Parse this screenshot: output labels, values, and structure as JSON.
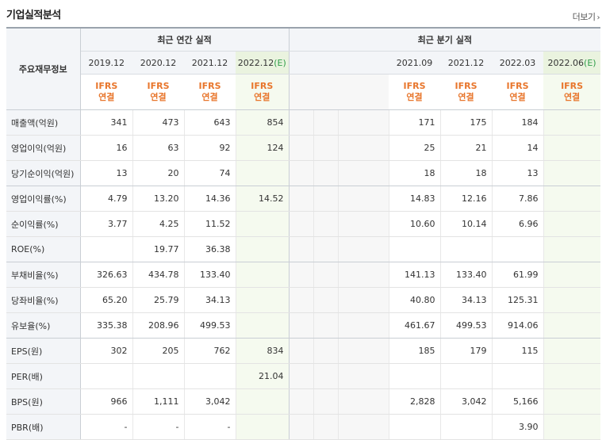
{
  "title": "기업실적분석",
  "more_label": "더보기",
  "label_header": "주요재무정보",
  "annual_header": "최근 연간 실적",
  "quarter_header": "최근 분기 실적",
  "annual_periods": [
    "2019.12",
    "2020.12",
    "2021.12",
    "2022.12"
  ],
  "annual_est_mark": "(E)",
  "quarter_periods": [
    "2021.09",
    "2021.12",
    "2022.03",
    "2022.06"
  ],
  "quarter_est_mark": "(E)",
  "ifrs_top": "IFRS",
  "ifrs_bottom": "연결",
  "rows": [
    {
      "label": "매출액(억원)",
      "annual": [
        "341",
        "473",
        "643",
        "854"
      ],
      "quarter": [
        "171",
        "175",
        "184",
        ""
      ]
    },
    {
      "label": "영업이익(억원)",
      "annual": [
        "16",
        "63",
        "92",
        "124"
      ],
      "quarter": [
        "25",
        "21",
        "14",
        ""
      ]
    },
    {
      "label": "당기순이익(억원)",
      "annual": [
        "13",
        "20",
        "74",
        ""
      ],
      "quarter": [
        "18",
        "18",
        "13",
        ""
      ]
    },
    {
      "label": "영업이익률(%)",
      "annual": [
        "4.79",
        "13.20",
        "14.36",
        "14.52"
      ],
      "quarter": [
        "14.83",
        "12.16",
        "7.86",
        ""
      ]
    },
    {
      "label": "순이익률(%)",
      "annual": [
        "3.77",
        "4.25",
        "11.52",
        ""
      ],
      "quarter": [
        "10.60",
        "10.14",
        "6.96",
        ""
      ]
    },
    {
      "label": "ROE(%)",
      "annual": [
        "",
        "19.77",
        "36.38",
        ""
      ],
      "quarter": [
        "",
        "",
        "",
        ""
      ]
    },
    {
      "label": "부채비율(%)",
      "annual": [
        "326.63",
        "434.78",
        "133.40",
        ""
      ],
      "quarter": [
        "141.13",
        "133.40",
        "61.99",
        ""
      ]
    },
    {
      "label": "당좌비율(%)",
      "annual": [
        "65.20",
        "25.79",
        "34.13",
        ""
      ],
      "quarter": [
        "40.80",
        "34.13",
        "125.31",
        ""
      ]
    },
    {
      "label": "유보율(%)",
      "annual": [
        "335.38",
        "208.96",
        "499.53",
        ""
      ],
      "quarter": [
        "461.67",
        "499.53",
        "914.06",
        ""
      ]
    },
    {
      "label": "EPS(원)",
      "annual": [
        "302",
        "205",
        "762",
        "834"
      ],
      "quarter": [
        "185",
        "179",
        "115",
        ""
      ]
    },
    {
      "label": "PER(배)",
      "annual": [
        "",
        "",
        "",
        "21.04"
      ],
      "quarter": [
        "",
        "",
        "",
        ""
      ]
    },
    {
      "label": "BPS(원)",
      "annual": [
        "966",
        "1,111",
        "3,042",
        ""
      ],
      "quarter": [
        "2,828",
        "3,042",
        "5,166",
        ""
      ]
    },
    {
      "label": "PBR(배)",
      "annual": [
        "-",
        "-",
        "-",
        ""
      ],
      "quarter": [
        "",
        "",
        "3.90",
        ""
      ]
    }
  ]
}
